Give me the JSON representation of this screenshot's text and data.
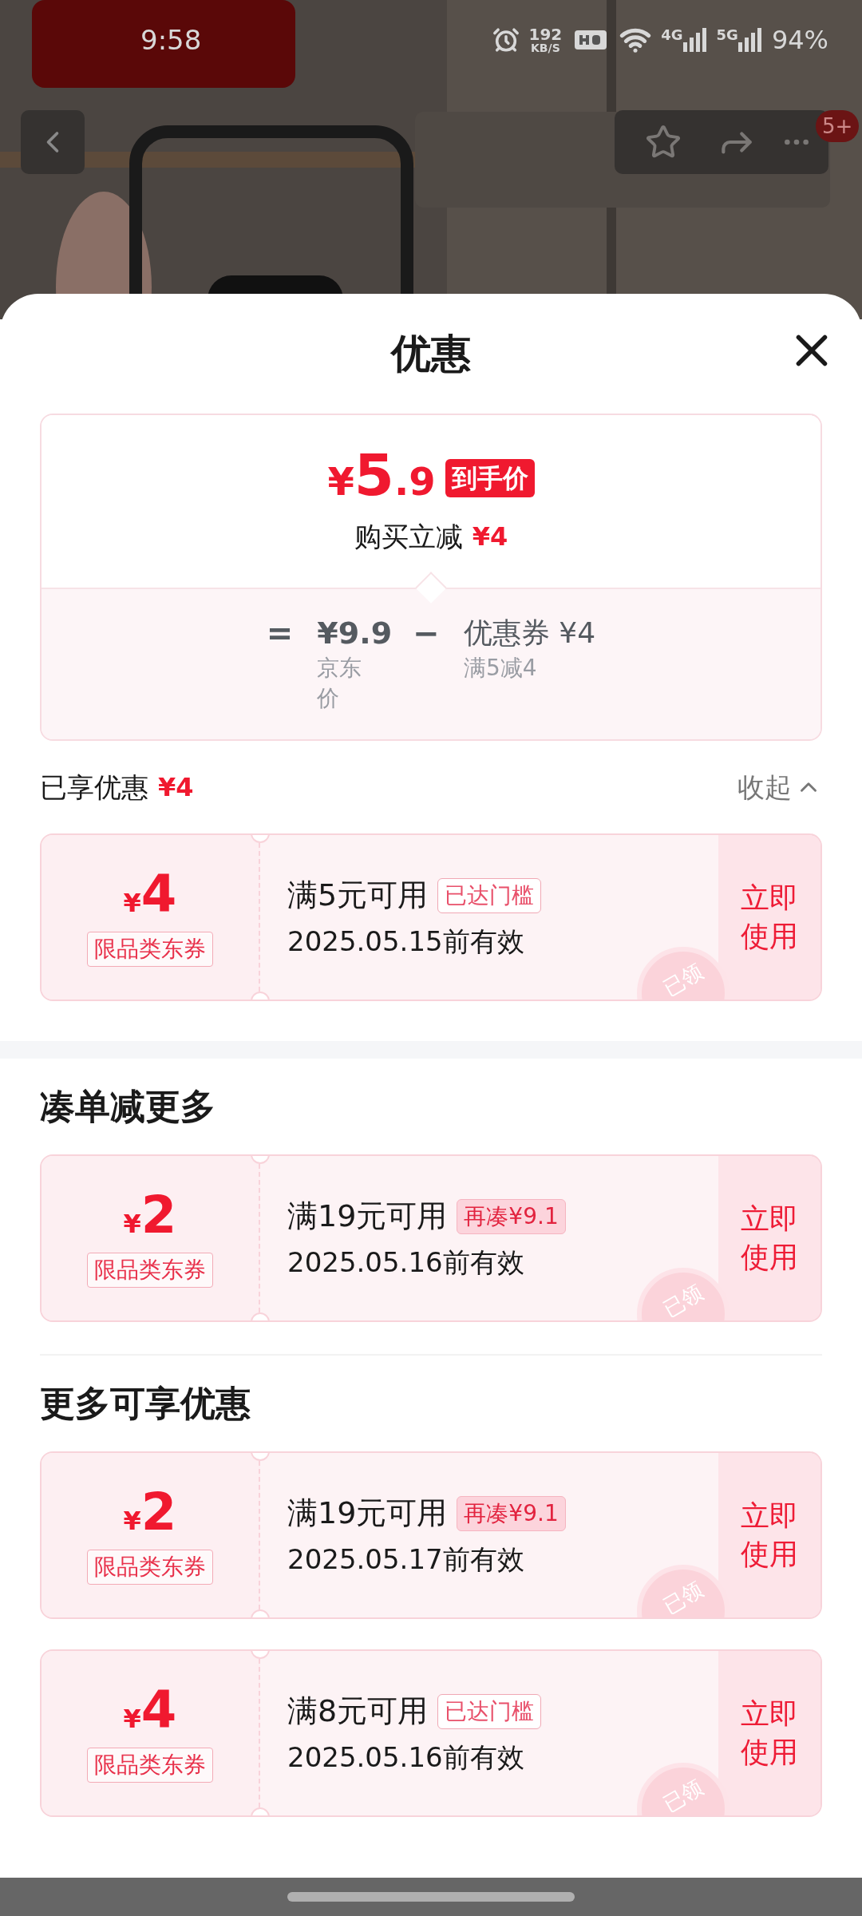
{
  "status_bar": {
    "time": "9:58",
    "speed": "192",
    "speed_unit": "KB/S",
    "network_1": "4G",
    "network_2": "5G",
    "battery": "94%"
  },
  "top_nav": {
    "badge": "5+"
  },
  "sheet": {
    "title": "优惠"
  },
  "price_card": {
    "currency": "¥",
    "price_int": "5",
    "price_dec": ".9",
    "price_tag": "到手价",
    "subtitle": "购买立减",
    "subtitle_amount": "¥4",
    "equals": "=",
    "base_price": "¥9.9",
    "base_label": "京东价",
    "minus": "−",
    "coupon_label": "优惠券 ¥4",
    "coupon_rule": "满5减4"
  },
  "applied": {
    "label": "已享优惠",
    "amount": "¥4",
    "toggle": "收起",
    "expanded": true,
    "coupons": [
      {
        "currency": "¥",
        "amount": "4",
        "category": "限品类东券",
        "condition": "满5元可用",
        "tag": {
          "kind": "reached",
          "text": "已达门槛"
        },
        "validity": "2025.05.15前有效",
        "action": "立即使用",
        "stamp": "已领"
      }
    ]
  },
  "sections": [
    {
      "title": "凑单减更多",
      "coupons": [
        {
          "currency": "¥",
          "amount": "2",
          "category": "限品类东券",
          "condition": "满19元可用",
          "tag": {
            "kind": "topup",
            "text": "再凑¥9.1"
          },
          "validity": "2025.05.16前有效",
          "action": "立即使用",
          "stamp": "已领"
        }
      ]
    },
    {
      "title": "更多可享优惠",
      "coupons": [
        {
          "currency": "¥",
          "amount": "2",
          "category": "限品类东券",
          "condition": "满19元可用",
          "tag": {
            "kind": "topup",
            "text": "再凑¥9.1"
          },
          "validity": "2025.05.17前有效",
          "action": "立即使用",
          "stamp": "已领"
        },
        {
          "currency": "¥",
          "amount": "4",
          "category": "限品类东券",
          "condition": "满8元可用",
          "tag": {
            "kind": "reached",
            "text": "已达门槛"
          },
          "validity": "2025.05.16前有效",
          "action": "立即使用",
          "stamp": "已领"
        }
      ]
    }
  ]
}
